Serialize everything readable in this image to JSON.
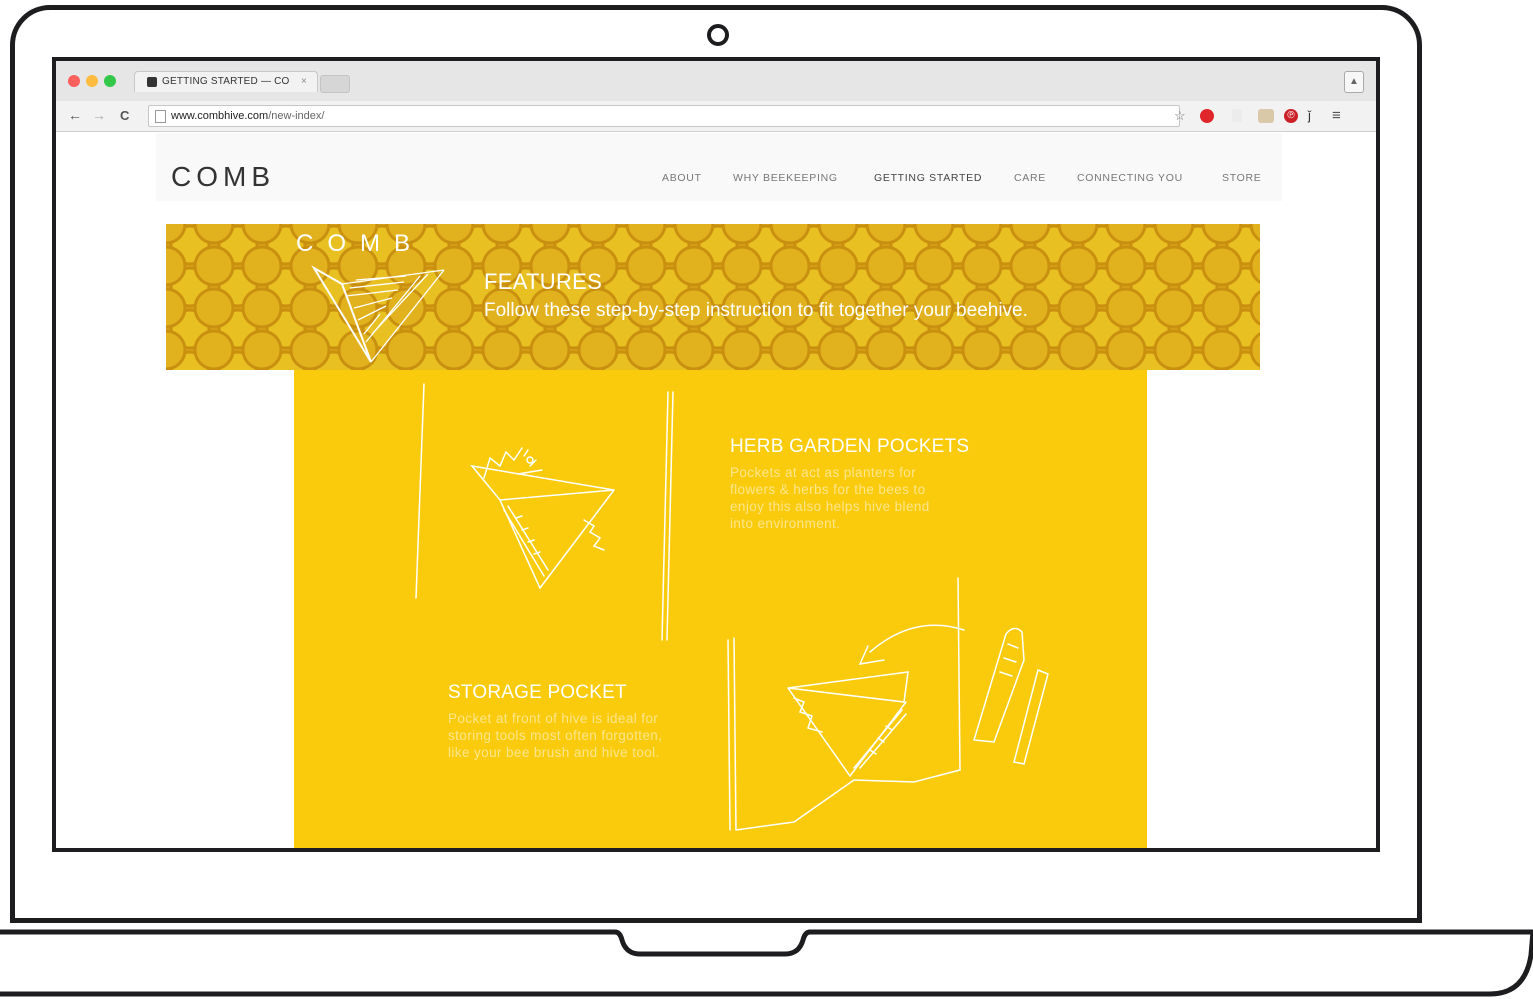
{
  "browser": {
    "tab_title": "GETTING STARTED — CO",
    "tab_close": "×",
    "url_host": "www.combhive.com",
    "url_path": "/new-index/",
    "nav_back": "←",
    "nav_forward": "→",
    "nav_reload": "C",
    "ext_star": "☆",
    "ext_pinterest": "℗",
    "ext_menu": "≡"
  },
  "site": {
    "logo": "COMB",
    "menu": [
      "ABOUT",
      "WHY BEEKEEPING",
      "GETTING STARTED",
      "CARE",
      "CONNECTING YOU",
      "STORE"
    ],
    "banner": {
      "logo": "COMB",
      "title": "FEATURES",
      "subtitle": "Follow these step-by-step instruction to fit together your beehive."
    },
    "features": [
      {
        "title": "HERB GARDEN POCKETS",
        "lines": [
          "Pockets at act as planters for",
          "flowers & herbs for the bees to",
          "enjoy this also helps hive blend",
          "into environment."
        ]
      },
      {
        "title": "STORAGE POCKET",
        "lines": [
          "Pocket at front of hive is ideal for",
          "storing tools most often forgotten,",
          "like your bee brush and hive tool."
        ]
      }
    ]
  },
  "colors": {
    "panel": "#facb0c",
    "banner": "#d9a71c",
    "frame": "#1d1d1f"
  }
}
